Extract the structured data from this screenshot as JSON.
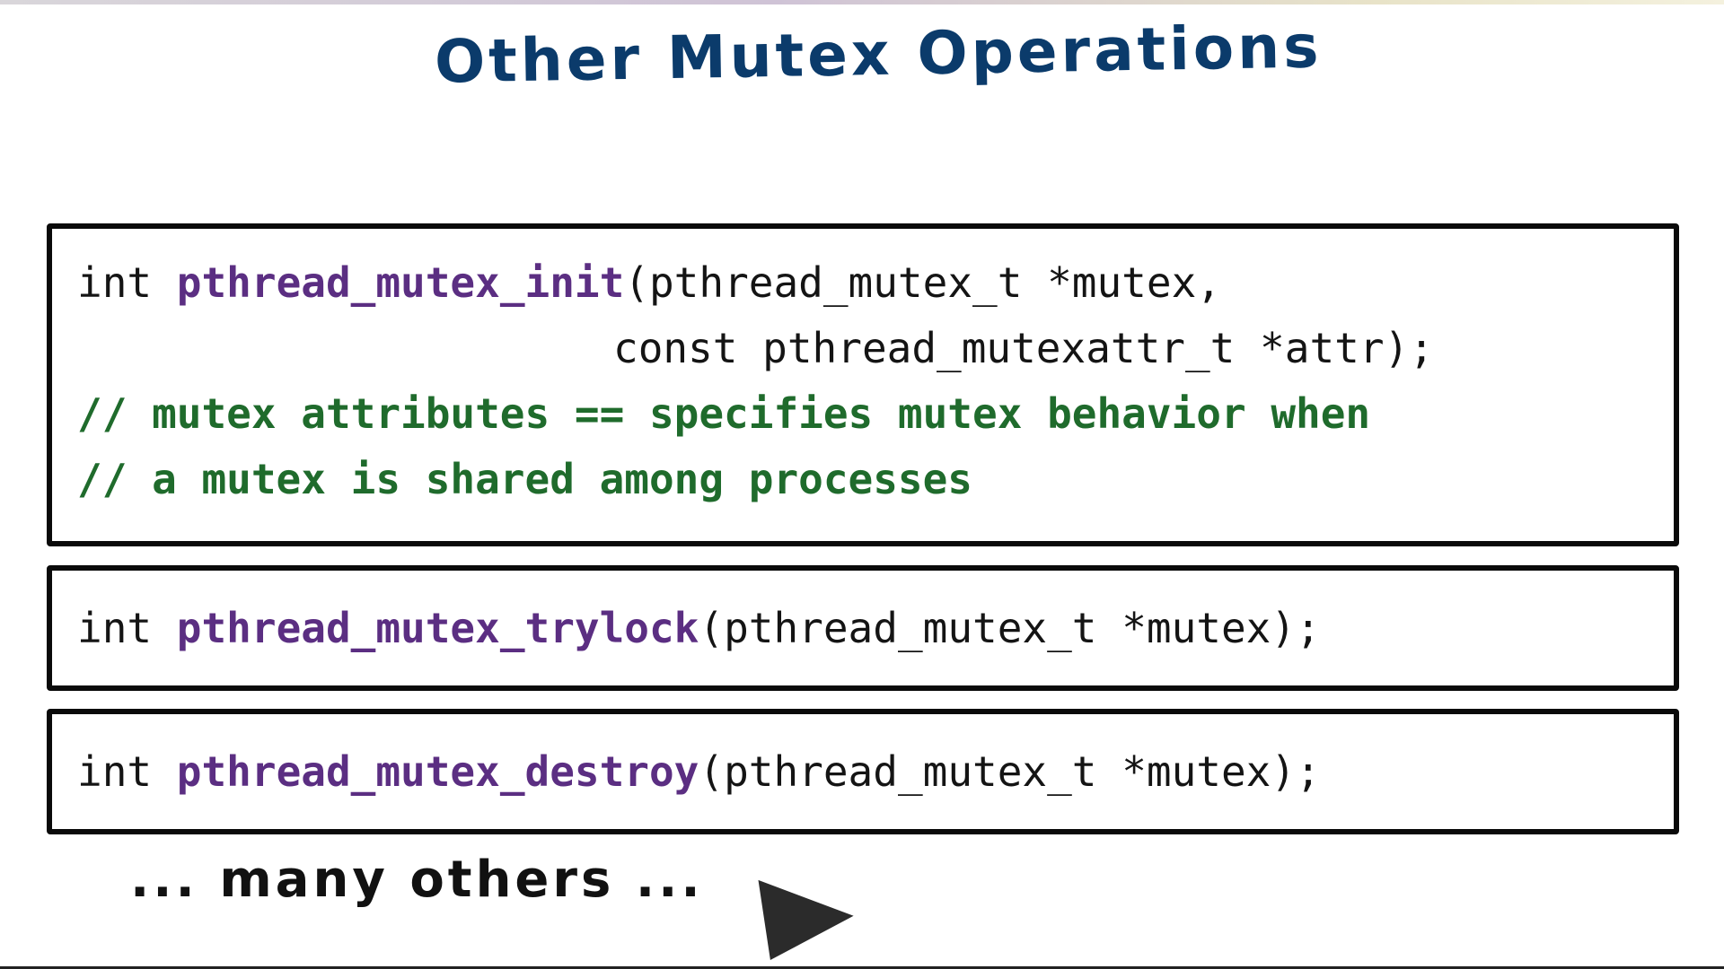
{
  "title": "Other Mutex Operations",
  "blocks": {
    "init": {
      "return_type": "int",
      "function_name": "pthread_mutex_init",
      "params_line1": "(pthread_mutex_t *mutex,",
      "params_line2": "const pthread_mutexattr_t *attr);",
      "comment_line1": "// mutex attributes == specifies mutex behavior when",
      "comment_line2": "// a mutex is shared among processes"
    },
    "trylock": {
      "return_type": "int",
      "function_name": "pthread_mutex_trylock",
      "params": "(pthread_mutex_t *mutex);"
    },
    "destroy": {
      "return_type": "int",
      "function_name": "pthread_mutex_destroy",
      "params": "(pthread_mutex_t *mutex);"
    }
  },
  "note": "... many others ...",
  "colors": {
    "title": "#0b3b6b",
    "function_name": "#5b2e82",
    "comment": "#1f6b2c",
    "text": "#141414"
  }
}
